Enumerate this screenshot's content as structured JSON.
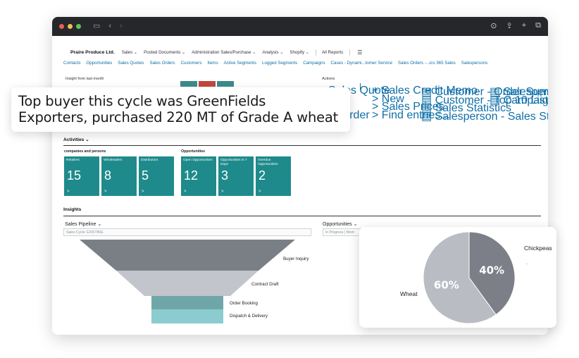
{
  "window": {
    "icons": [
      "sidebar-toggle-icon",
      "back-icon",
      "forward-icon",
      "download-icon",
      "share-icon",
      "new-tab-icon",
      "tabs-icon"
    ]
  },
  "topnav": {
    "company": "Praire Produce Ltd.",
    "items": [
      "Sales",
      "Posted Documents",
      "Administration Sales/Purchase",
      "Analysis",
      "Shopify"
    ],
    "all_reports": "All Reports",
    "menu_glyph": "☰"
  },
  "subnav": {
    "links": [
      "Contacts",
      "Opportunities",
      "Sales Quotes",
      "Sales Orders",
      "Customers",
      "Items",
      "Active Segments",
      "Logged Segments",
      "Campaigns",
      "Cases - Dynami...tomer Service",
      "Sales Orders -...ics 365 Sales",
      "Salespersons"
    ]
  },
  "insight": {
    "label": "Insight from last month"
  },
  "actions": {
    "header": "Actions",
    "col1": [
      "Sales Quote",
      "ice",
      "er",
      "m Order"
    ],
    "col2": [
      "+ Sales Credit Memo",
      "> New",
      "> Sales Prices",
      "> Find entries..."
    ],
    "col3": [
      "Customer - Order Summary",
      "Customer - Top 10 List",
      "Sales Statistics",
      "Salesperson - Sales Statistics"
    ],
    "col4": [
      "Salesperson - Commiss",
      "Campaign - Details"
    ]
  },
  "callout": {
    "line1": "Top buyer this cycle was GreenFields",
    "line2": "Exporters, purchased 220 MT of Grade A wheat"
  },
  "activities": {
    "title": "Activities",
    "group1": {
      "label": "companies and persons",
      "tiles": [
        {
          "label": "Retailers",
          "value": "15"
        },
        {
          "label": "Wholesalers",
          "value": "8"
        },
        {
          "label": "Distributors",
          "value": "5"
        }
      ]
    },
    "group2": {
      "label": "Opportunities",
      "tiles": [
        {
          "label": "Open Opportunities",
          "value": "12"
        },
        {
          "label": "Opportunities in 7 Days",
          "value": "3"
        },
        {
          "label": "Overdue Opportunities",
          "value": "2"
        }
      ]
    },
    "tile_arrow": ">"
  },
  "insights": {
    "title": "Insights",
    "pipeline_label": "Sales Pipeline",
    "pipeline_filter": "Sales Cycle: EXISTING",
    "opps_label": "Opportunities",
    "opps_filter": "In Progress | Mont",
    "funnel_stages": [
      "Buyer Inquiry",
      "Contract Draft",
      "Order Booking",
      "Dispatch & Delivery"
    ]
  },
  "pie": {
    "slices": [
      {
        "name": "Chickpeas",
        "value": 40,
        "label": "40%",
        "color": "#7c7f87"
      },
      {
        "name": "Wheat",
        "value": 60,
        "label": "60%",
        "color": "#b9bcc3"
      }
    ],
    "dot": "."
  },
  "colors": {
    "tile": "#1f8a8b",
    "link": "#0f6fa8",
    "funnel_grey_dark": "#7a7f86",
    "funnel_grey_light": "#c2c5cb",
    "funnel_teal_dark": "#6fa7a9",
    "funnel_teal_light": "#8ccbd0"
  }
}
